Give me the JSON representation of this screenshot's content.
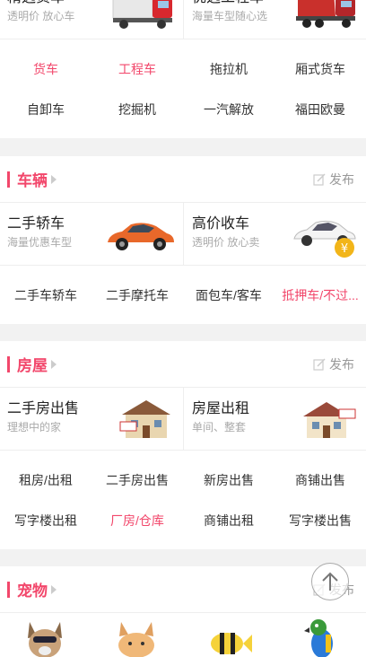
{
  "trucks": {
    "cards": [
      {
        "title": "精选货车",
        "sub": "透明价 放心车"
      },
      {
        "title": "优选工程车",
        "sub": "海量车型随心选"
      }
    ],
    "links": [
      {
        "label": "货车",
        "hot": true
      },
      {
        "label": "工程车",
        "hot": true
      },
      {
        "label": "拖拉机",
        "hot": false
      },
      {
        "label": "厢式货车",
        "hot": false
      },
      {
        "label": "自卸车",
        "hot": false
      },
      {
        "label": "挖掘机",
        "hot": false
      },
      {
        "label": "一汽解放",
        "hot": false
      },
      {
        "label": "福田欧曼",
        "hot": false
      }
    ]
  },
  "vehicles": {
    "title": "车辆",
    "post_label": "发布",
    "cards": [
      {
        "title": "二手轿车",
        "sub": "海量优惠车型"
      },
      {
        "title": "高价收车",
        "sub": "透明价 放心卖"
      }
    ],
    "links": [
      {
        "label": "二手车轿车",
        "hot": false
      },
      {
        "label": "二手摩托车",
        "hot": false
      },
      {
        "label": "面包车/客车",
        "hot": false
      },
      {
        "label": "抵押车/不过...",
        "hot": true
      }
    ]
  },
  "housing": {
    "title": "房屋",
    "post_label": "发布",
    "cards": [
      {
        "title": "二手房出售",
        "sub": "理想中的家"
      },
      {
        "title": "房屋出租",
        "sub": "单间、整套"
      }
    ],
    "links": [
      {
        "label": "租房/出租",
        "hot": false
      },
      {
        "label": "二手房出售",
        "hot": false
      },
      {
        "label": "新房出售",
        "hot": false
      },
      {
        "label": "商铺出售",
        "hot": false
      },
      {
        "label": "写字楼出租",
        "hot": false
      },
      {
        "label": "厂房/仓库",
        "hot": true
      },
      {
        "label": "商铺出租",
        "hot": false
      },
      {
        "label": "写字楼出售",
        "hot": false
      }
    ]
  },
  "pets": {
    "title": "宠物",
    "post_label": "发布"
  },
  "colors": {
    "accent": "#f2476b",
    "muted": "#999999"
  }
}
